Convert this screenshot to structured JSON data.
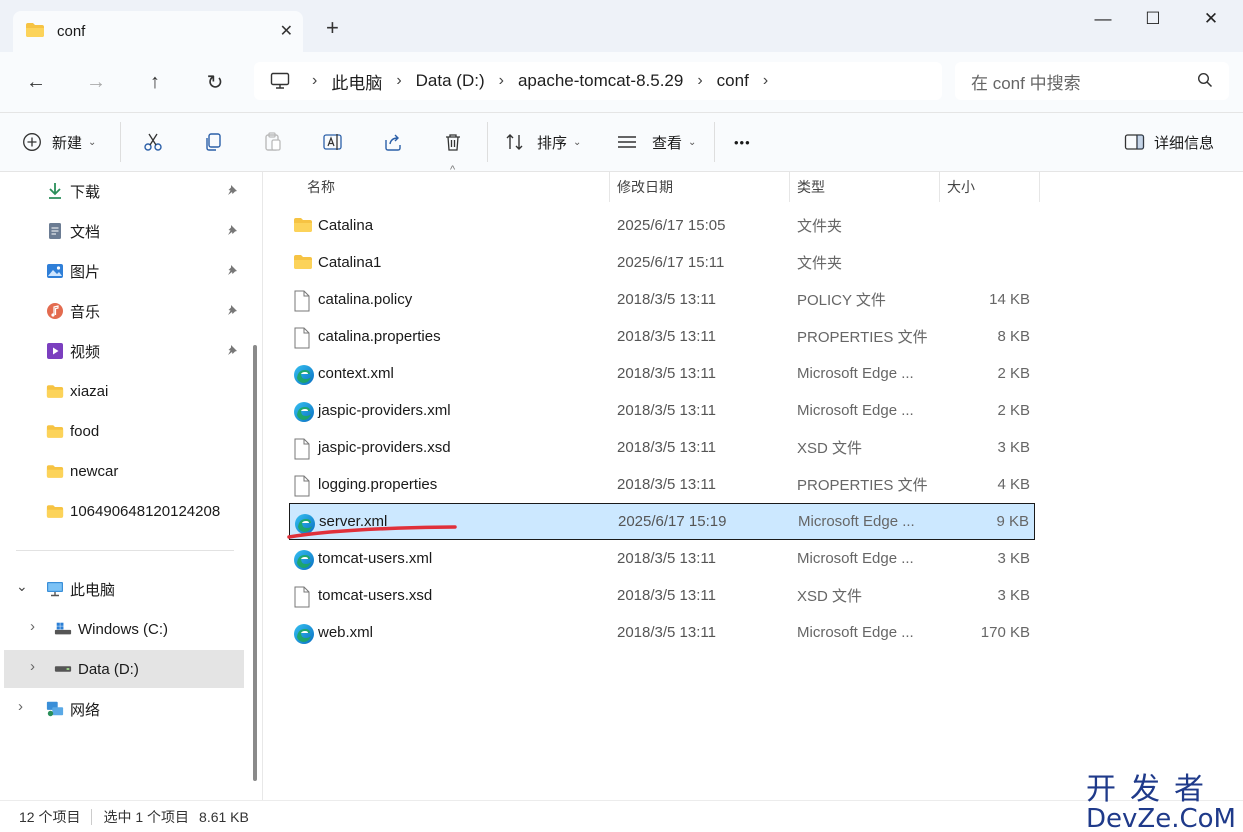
{
  "window": {
    "tab_title": "conf",
    "close_tab_glyph": "✕",
    "new_tab_glyph": "+",
    "minimize_glyph": "—",
    "maximize_glyph": "☐",
    "close_glyph": "✕"
  },
  "nav": {
    "back_icon": "←",
    "forward_icon": "→",
    "up_icon": "↑",
    "refresh_icon": "↻",
    "breadcrumb": [
      "此电脑",
      "Data (D:)",
      "apache-tomcat-8.5.29",
      "conf"
    ],
    "breadcrumb_chevron": "›",
    "search_placeholder": "在 conf 中搜索"
  },
  "commands": {
    "new_label": "新建",
    "sort_label": "排序",
    "view_label": "查看",
    "more_label": "•••",
    "details_label": "详细信息",
    "caret": "⌄"
  },
  "sidebar": {
    "quick_access": [
      {
        "label": "下载",
        "icon": "download-icon",
        "pinned": true
      },
      {
        "label": "文档",
        "icon": "document-icon",
        "pinned": true
      },
      {
        "label": "图片",
        "icon": "pictures-icon",
        "pinned": true
      },
      {
        "label": "音乐",
        "icon": "music-icon",
        "pinned": true
      },
      {
        "label": "视频",
        "icon": "video-icon",
        "pinned": true
      },
      {
        "label": "xiazai",
        "icon": "folder-icon",
        "pinned": false
      },
      {
        "label": "food",
        "icon": "folder-icon",
        "pinned": false
      },
      {
        "label": "newcar",
        "icon": "folder-icon",
        "pinned": false
      },
      {
        "label": "106490648120124208",
        "icon": "folder-icon",
        "pinned": false
      }
    ],
    "pin_glyph": "📌",
    "this_pc": "此电脑",
    "drives": [
      "Windows (C:)",
      "Data (D:)"
    ],
    "network": "网络",
    "expand_glyph": "›",
    "collapse_glyph": "⌄"
  },
  "file_list": {
    "columns": [
      "名称",
      "修改日期",
      "类型",
      "大小"
    ],
    "sort_indicator": "^",
    "rows": [
      {
        "name": "Catalina",
        "date": "2025/6/17 15:05",
        "type": "文件夹",
        "size": "",
        "icon": "folder-icon",
        "selected": false
      },
      {
        "name": "Catalina1",
        "date": "2025/6/17 15:11",
        "type": "文件夹",
        "size": "",
        "icon": "folder-icon",
        "selected": false
      },
      {
        "name": "catalina.policy",
        "date": "2018/3/5 13:11",
        "type": "POLICY 文件",
        "size": "14 KB",
        "icon": "file-icon",
        "selected": false
      },
      {
        "name": "catalina.properties",
        "date": "2018/3/5 13:11",
        "type": "PROPERTIES 文件",
        "size": "8 KB",
        "icon": "file-icon",
        "selected": false
      },
      {
        "name": "context.xml",
        "date": "2018/3/5 13:11",
        "type": "Microsoft Edge ...",
        "size": "2 KB",
        "icon": "edge-icon",
        "selected": false
      },
      {
        "name": "jaspic-providers.xml",
        "date": "2018/3/5 13:11",
        "type": "Microsoft Edge ...",
        "size": "2 KB",
        "icon": "edge-icon",
        "selected": false
      },
      {
        "name": "jaspic-providers.xsd",
        "date": "2018/3/5 13:11",
        "type": "XSD 文件",
        "size": "3 KB",
        "icon": "file-icon",
        "selected": false
      },
      {
        "name": "logging.properties",
        "date": "2018/3/5 13:11",
        "type": "PROPERTIES 文件",
        "size": "4 KB",
        "icon": "file-icon",
        "selected": false
      },
      {
        "name": "server.xml",
        "date": "2025/6/17 15:19",
        "type": "Microsoft Edge ...",
        "size": "9 KB",
        "icon": "edge-icon",
        "selected": true
      },
      {
        "name": "tomcat-users.xml",
        "date": "2018/3/5 13:11",
        "type": "Microsoft Edge ...",
        "size": "3 KB",
        "icon": "edge-icon",
        "selected": false
      },
      {
        "name": "tomcat-users.xsd",
        "date": "2018/3/5 13:11",
        "type": "XSD 文件",
        "size": "3 KB",
        "icon": "file-icon",
        "selected": false
      },
      {
        "name": "web.xml",
        "date": "2018/3/5 13:11",
        "type": "Microsoft Edge ...",
        "size": "170 KB",
        "icon": "edge-icon",
        "selected": false
      }
    ]
  },
  "status": {
    "item_count": "12 个项目",
    "selection": "选中 1 个项目",
    "selection_size": "8.61 KB"
  },
  "watermark": {
    "line1": "开发者",
    "line2": "DevZe.CoM"
  },
  "colors": {
    "accent": "#0067c0",
    "selection_bg": "#cce8ff",
    "folder": "#f6c343",
    "annotation_red": "#e0303a"
  }
}
